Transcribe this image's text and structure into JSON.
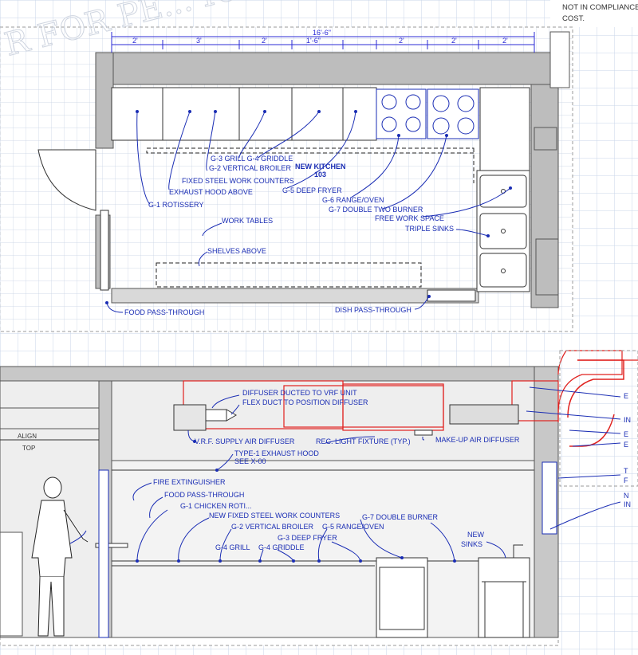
{
  "compliance_note": [
    "NOT IN COMPLIANCE",
    "COST."
  ],
  "watermark": "R FOR PE... ION OF PL...",
  "plan": {
    "overall_dimension": "16'-6\"",
    "segment_dimensions": [
      "2'",
      "3'",
      "2'",
      "1'-6\"",
      "2'",
      "2'",
      "2'"
    ],
    "room_name": "NEW KITCHEN",
    "room_number": "103",
    "labels": {
      "grill_griddle": "G-3 GRILL  G-4 GRIDDLE",
      "vertical_broiler": "G-2 VERTICAL BROILER",
      "work_counters": "FIXED STEEL WORK COUNTERS",
      "exhaust_hood": "EXHAUST HOOD ABOVE",
      "rotisserie": "G-1 ROTISSERY",
      "deep_fryer": "G-5 DEEP FRYER",
      "range_oven": "G-6 RANGE/OVEN",
      "double_burner": "G-7 DOUBLE TWO BURNER",
      "free_work_space": "FREE WORK SPACE",
      "triple_sinks": "TRIPLE SINKS",
      "work_tables": "WORK TABLES",
      "shelves_above": "SHELVES ABOVE",
      "food_pass": "FOOD PASS-THROUGH",
      "dish_pass": "DISH PASS-THROUGH"
    }
  },
  "elevation": {
    "align_top": [
      "ALIGN",
      "TOP"
    ],
    "labels": {
      "diffuser_ducted": "DIFFUSER DUCTED TO VRF UNIT",
      "flex_duct": "FLEX DUCT TO POSITION DIFFUSER",
      "vrf_supply": "V.R.F. SUPPLY AIR DIFFUSER",
      "light_fixture": "REC. LIGHT FIXTURE (TYP.)",
      "makeup_air": "MAKE-UP AIR DIFFUSER",
      "exhaust_hood_1": "TYPE-1  EXHAUST HOOD",
      "exhaust_hood_2": "SEE X-00",
      "fire_ext": "FIRE EXTINGUISHER",
      "food_pass": "FOOD PASS-THROUGH",
      "chicken_roti": "G-1  CHICKEN ROTI...",
      "new_counters": "NEW FIXED STEEL WORK COUNTERS",
      "double_burner": "G-7  DOUBLE BURNER",
      "vertical_broiler": "G-2  VERTICAL BROILER",
      "range_oven": "G-5  RANGE/OVEN",
      "deep_fryer": "G-3  DEEP FRYER",
      "grill": "G-4 GRILL",
      "griddle": "G-4  GRIDDLE",
      "new_sinks_1": "NEW",
      "new_sinks_2": "SINKS"
    },
    "edge_letters": [
      "E",
      "IN",
      "E",
      "E",
      "T",
      "F",
      "N",
      "IN"
    ]
  }
}
